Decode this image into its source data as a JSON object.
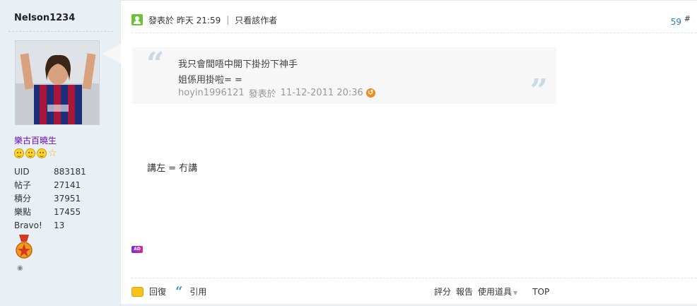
{
  "author": {
    "name": "Nelson1234",
    "group": "樂古百曉生",
    "stats": [
      {
        "key": "UID",
        "value": "883181"
      },
      {
        "key": "帖子",
        "value": "27141"
      },
      {
        "key": "積分",
        "value": "37951"
      },
      {
        "key": "樂點",
        "value": "17455"
      },
      {
        "key": "Bravo!",
        "value": "13"
      }
    ]
  },
  "post": {
    "time": "發表於 昨天 21:59",
    "only_author": "只看該作者",
    "floor": "59",
    "floor_hash": "#",
    "quote": {
      "line1": "我只會間唔中開下掛扮下神手",
      "line2": "姐係用掛啦= =",
      "user": "hoyin1996121",
      "posted_at_label": "發表於",
      "date": "11-12-2011 20:36"
    },
    "body": "講左 = 冇講",
    "ad_label": "AD"
  },
  "footer": {
    "reply": "回復",
    "quote": "引用",
    "rate": "評分",
    "report": "報告",
    "tools": "使用道具",
    "top": "TOP"
  },
  "colors": {
    "sidebar_bg": "#e8eff5",
    "link_blue": "#2a7fc1",
    "group_purple": "#6a0dbd",
    "quote_bg": "#f7f7f7",
    "online_green": "#6fbf3b"
  }
}
